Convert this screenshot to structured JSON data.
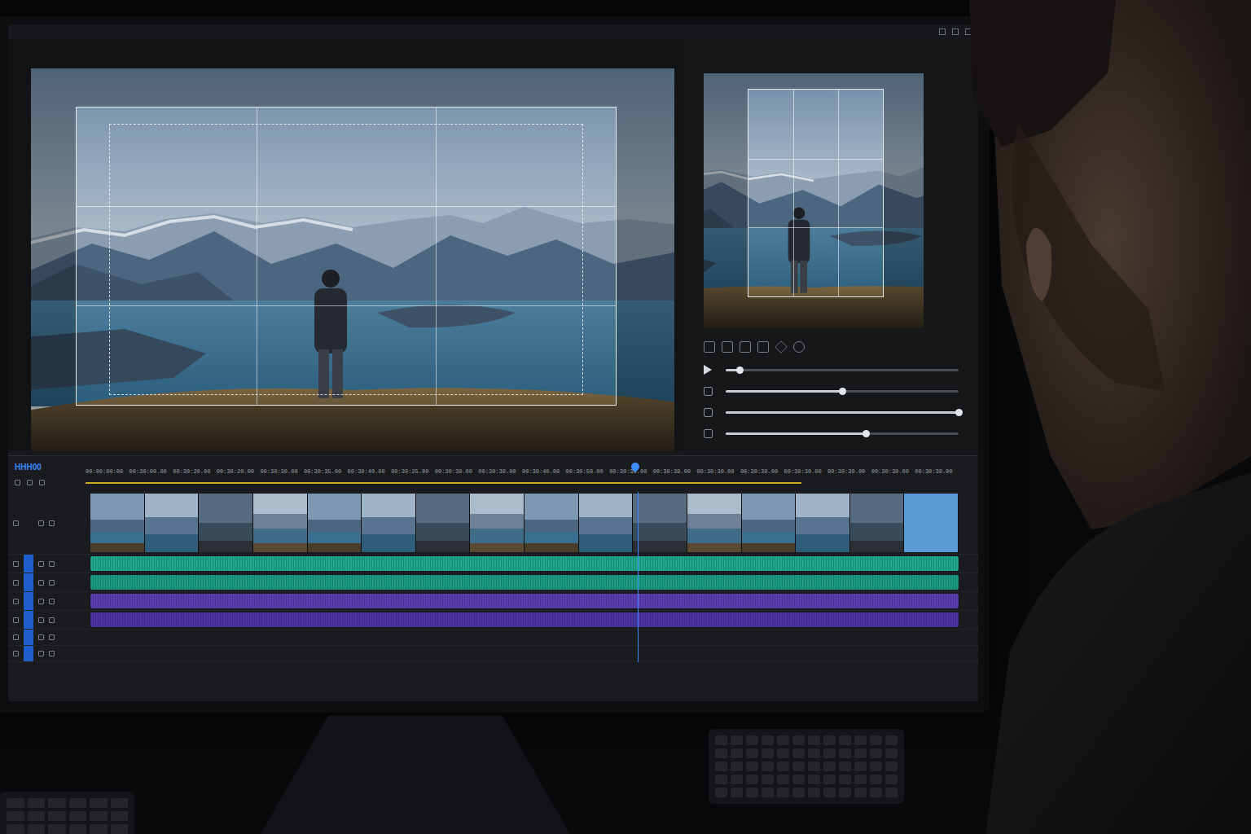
{
  "inspector": {
    "sliders": [
      {
        "level": 0.06
      },
      {
        "level": 0.5
      },
      {
        "level": 1.0
      },
      {
        "level": 0.6
      }
    ]
  },
  "timeline": {
    "label": "HHH00",
    "ruler": [
      "00:00:00:00",
      "00:30:00.00",
      "00:30:20.00",
      "00:30:20.00",
      "00:30:30.00",
      "00:30:35.00",
      "00:30:40.00",
      "00:30:25.00",
      "00:30:30.00",
      "00:30:30.00",
      "00:30:40.00",
      "00:30:50.00",
      "00:30:30.00",
      "00:30:39.00",
      "00:30:30.00",
      "00:30:30.00",
      "00:30:30.00",
      "00:30:30.00",
      "00:30:30.00",
      "00:30:30.00"
    ],
    "work_area": {
      "level": 0.82
    },
    "playhead": {
      "level": 0.63
    },
    "tracks": [
      {
        "kind": "video",
        "targeted": false,
        "clips": [
          {
            "selected": false
          },
          {
            "selected": false
          },
          {
            "selected": false
          },
          {
            "selected": false
          },
          {
            "selected": false
          },
          {
            "selected": false
          },
          {
            "selected": false
          },
          {
            "selected": false
          },
          {
            "selected": false
          },
          {
            "selected": false
          },
          {
            "selected": false
          },
          {
            "selected": false
          },
          {
            "selected": false
          },
          {
            "selected": false
          },
          {
            "selected": false
          },
          {
            "selected": true
          }
        ]
      },
      {
        "kind": "audio",
        "targeted": true,
        "color": "#1fa88f"
      },
      {
        "kind": "audio",
        "targeted": true,
        "color": "#1b9a85"
      },
      {
        "kind": "audio",
        "targeted": true,
        "color": "#5a3fb0"
      },
      {
        "kind": "audio",
        "targeted": true,
        "color": "#4a34a0"
      },
      {
        "kind": "empty",
        "targeted": true
      },
      {
        "kind": "empty",
        "targeted": true
      }
    ]
  }
}
